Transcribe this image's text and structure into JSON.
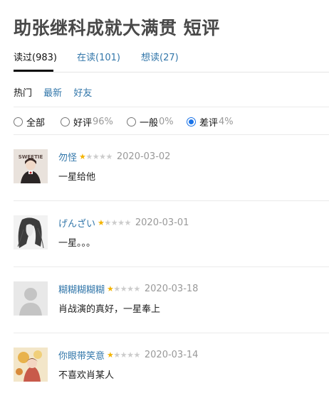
{
  "title": "助张继科成就大满贯 短评",
  "tabs": [
    {
      "label": "读过(983)"
    },
    {
      "label": "在读(101)"
    },
    {
      "label": "想读(27)"
    }
  ],
  "sort": [
    {
      "label": "热门"
    },
    {
      "label": "最新"
    },
    {
      "label": "好友"
    }
  ],
  "filters": [
    {
      "label": "全部",
      "pct": ""
    },
    {
      "label": "好评",
      "pct": "96%"
    },
    {
      "label": "一般",
      "pct": "0%"
    },
    {
      "label": "差评",
      "pct": "4%"
    }
  ],
  "selected_filter": "差评",
  "colors": {
    "link": "#3377aa",
    "star": "#f4b400",
    "muted": "#999999"
  },
  "reviews": [
    {
      "user": "勿怪",
      "rating": 1,
      "max_rating": 5,
      "date": "2020-03-02",
      "content": "一星给他",
      "avatar_text": "SWEETIE"
    },
    {
      "user": "げんざい",
      "rating": 1,
      "max_rating": 5,
      "date": "2020-03-01",
      "content": "一星。。。"
    },
    {
      "user": "糊糊糊糊糊",
      "rating": 1,
      "max_rating": 5,
      "date": "2020-03-18",
      "content": "肖战演的真好，一星奉上"
    },
    {
      "user": "你眼带笑意",
      "rating": 1,
      "max_rating": 5,
      "date": "2020-03-14",
      "content": "不喜欢肖某人"
    }
  ]
}
